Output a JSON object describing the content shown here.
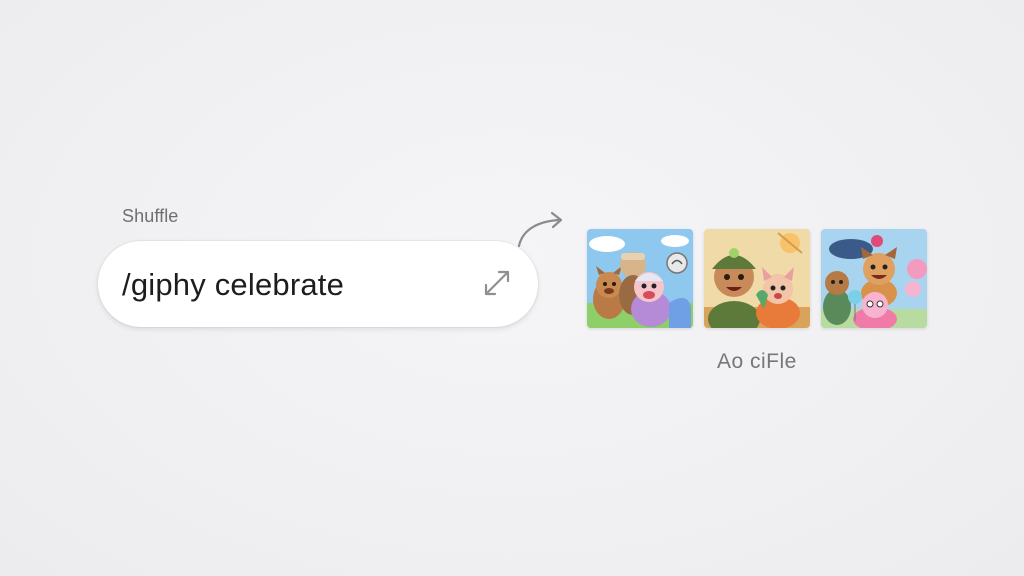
{
  "shuffle": {
    "label": "Shuffle"
  },
  "command_bar": {
    "value": "/giphy celebrate",
    "action_icon": "expand-arrows-icon"
  },
  "transition_icon": "curved-arrow-icon",
  "results": {
    "items": [
      {
        "alt": "celebrating cartoon animals",
        "icon": "gif-thumbnail"
      },
      {
        "alt": "cartoon boy with cat",
        "icon": "gif-thumbnail"
      },
      {
        "alt": "cartoon puppies with balloons",
        "icon": "gif-thumbnail"
      }
    ],
    "caption": "Ao ciFle"
  },
  "colors": {
    "background": "#f1f1f3",
    "bar": "#ffffff",
    "text": "#1d1d1f",
    "muted": "#6e6e73"
  }
}
